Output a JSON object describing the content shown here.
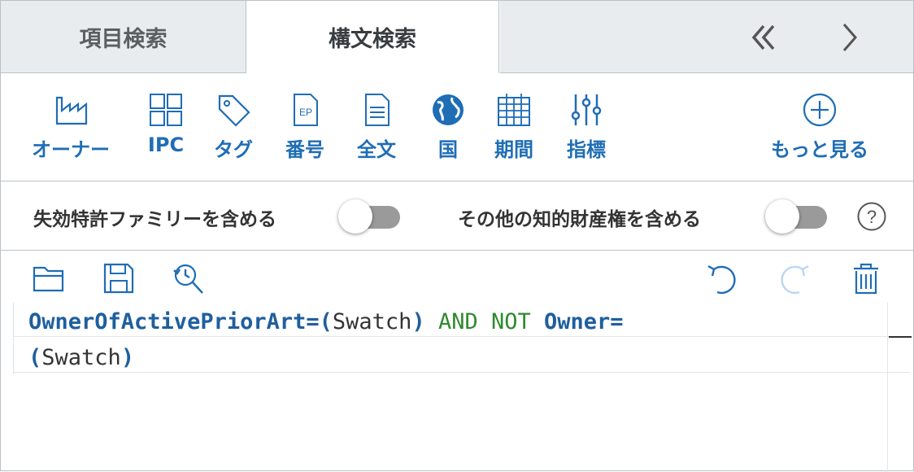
{
  "tabs": [
    {
      "label": "項目検索",
      "active": false
    },
    {
      "label": "構文検索",
      "active": true
    }
  ],
  "nav": {
    "back_double_icon": "double-chevron-left-icon",
    "forward_icon": "chevron-right-icon"
  },
  "filters": [
    {
      "label": "オーナー",
      "icon": "factory-icon"
    },
    {
      "label": "IPC",
      "icon": "grid-icon"
    },
    {
      "label": "タグ",
      "icon": "tag-icon"
    },
    {
      "label": "番号",
      "icon": "ep-document-icon",
      "icon_text": "EP"
    },
    {
      "label": "全文",
      "icon": "document-icon"
    },
    {
      "label": "国",
      "icon": "globe-icon"
    },
    {
      "label": "期間",
      "icon": "calendar-icon"
    },
    {
      "label": "指標",
      "icon": "sliders-icon"
    },
    {
      "label": "もっと見る",
      "icon": "plus-circle-icon"
    }
  ],
  "toggles": [
    {
      "label": "失効特許ファミリーを含める",
      "on": false
    },
    {
      "label": "その他の知的財産権を含める",
      "on": false
    }
  ],
  "help_label": "?",
  "actions": {
    "open": "folder-open-icon",
    "save": "save-icon",
    "history": "history-search-icon",
    "undo": "undo-icon",
    "redo": "redo-icon",
    "delete": "trash-icon"
  },
  "query": {
    "line1": [
      {
        "text": "OwnerOfActivePriorArt",
        "kind": "key"
      },
      {
        "text": "=(",
        "kind": "op"
      },
      {
        "text": "Swatch",
        "kind": "val"
      },
      {
        "text": ")",
        "kind": "op"
      },
      {
        "text": " AND NOT ",
        "kind": "bool"
      },
      {
        "text": "Owner",
        "kind": "key"
      },
      {
        "text": "=",
        "kind": "op"
      }
    ],
    "line2": [
      {
        "text": "(",
        "kind": "op"
      },
      {
        "text": "Swatch",
        "kind": "val"
      },
      {
        "text": ")",
        "kind": "op"
      }
    ]
  },
  "colors": {
    "accent": "#1f6db5",
    "keyword": "#1f5f9e",
    "boolean": "#2f8a2f",
    "tab_inactive_bg": "#e9ecee",
    "toggle_off": "#9a9a9a"
  }
}
